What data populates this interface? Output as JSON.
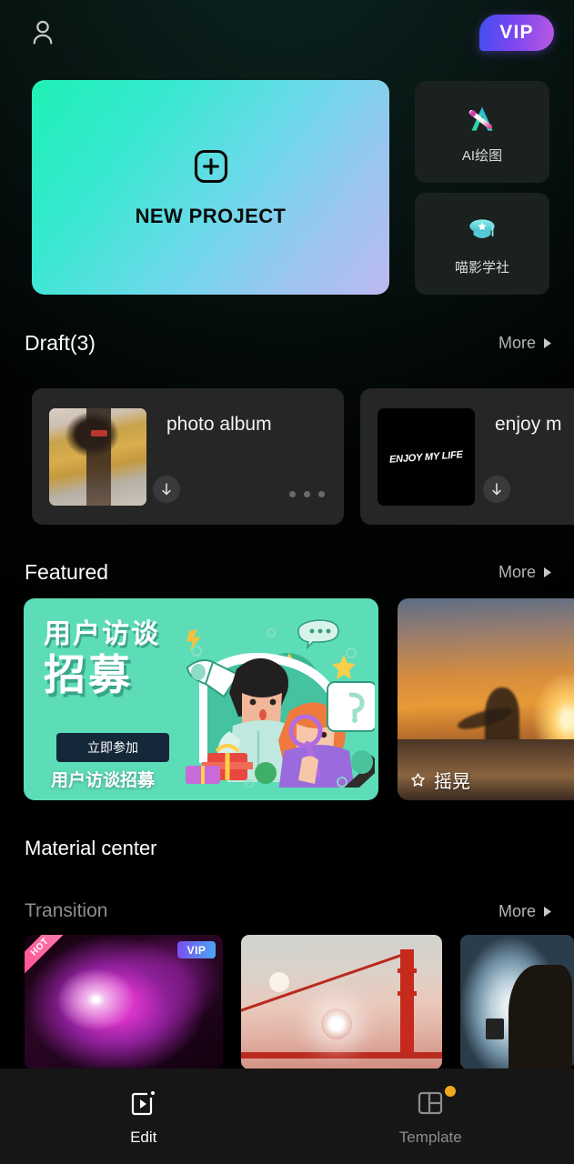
{
  "app": {
    "background_color": "#000000",
    "accent_teal": "#1ff0b4",
    "accent_purple": "#bb5ae2"
  },
  "topbar": {
    "account_icon": "person-icon",
    "vip_label": "VIP"
  },
  "hero": {
    "new_project": {
      "label": "NEW PROJECT",
      "icon": "plus-square-icon"
    },
    "tiles": [
      {
        "label": "AI绘图",
        "icon": "ai-draw-icon"
      },
      {
        "label": "喵影学社",
        "icon": "graduation-cap-icon"
      }
    ]
  },
  "sections": {
    "draft": {
      "title": "Draft(3)",
      "more_label": "More",
      "items": [
        {
          "name": "photo album",
          "thumb": "woman-yellow-sweater-thumb",
          "download_icon": "download-icon",
          "menu_icon": "more-dots-icon"
        },
        {
          "name": "enjoy m",
          "thumb_text": "ENJOY MY LIFE",
          "download_icon": "download-icon"
        }
      ]
    },
    "featured": {
      "title": "Featured",
      "more_label": "More",
      "items": [
        {
          "headline_line1": "用户访谈",
          "headline_line2": "招募",
          "button_label": "立即参加",
          "caption": "用户访谈招募",
          "background_color": "#5ddcb8"
        },
        {
          "label": "摇晃",
          "icon": "effect-star-icon",
          "thumb": "sunset-surfer-thumb"
        }
      ]
    },
    "material_center": {
      "title": "Material center",
      "sub_title": "Transition",
      "more_label": "More",
      "items": [
        {
          "thumb": "purple-nebula-thumb",
          "badge_hot": "HOT",
          "badge_vip": "VIP"
        },
        {
          "thumb": "golden-gate-bridge-thumb"
        },
        {
          "thumb": "tunnel-silhouette-thumb"
        }
      ]
    }
  },
  "bottom_nav": {
    "items": [
      {
        "label": "Edit",
        "icon": "edit-video-icon",
        "active": true,
        "has_dot": false
      },
      {
        "label": "Template",
        "icon": "template-grid-icon",
        "active": false,
        "has_dot": true
      }
    ]
  }
}
